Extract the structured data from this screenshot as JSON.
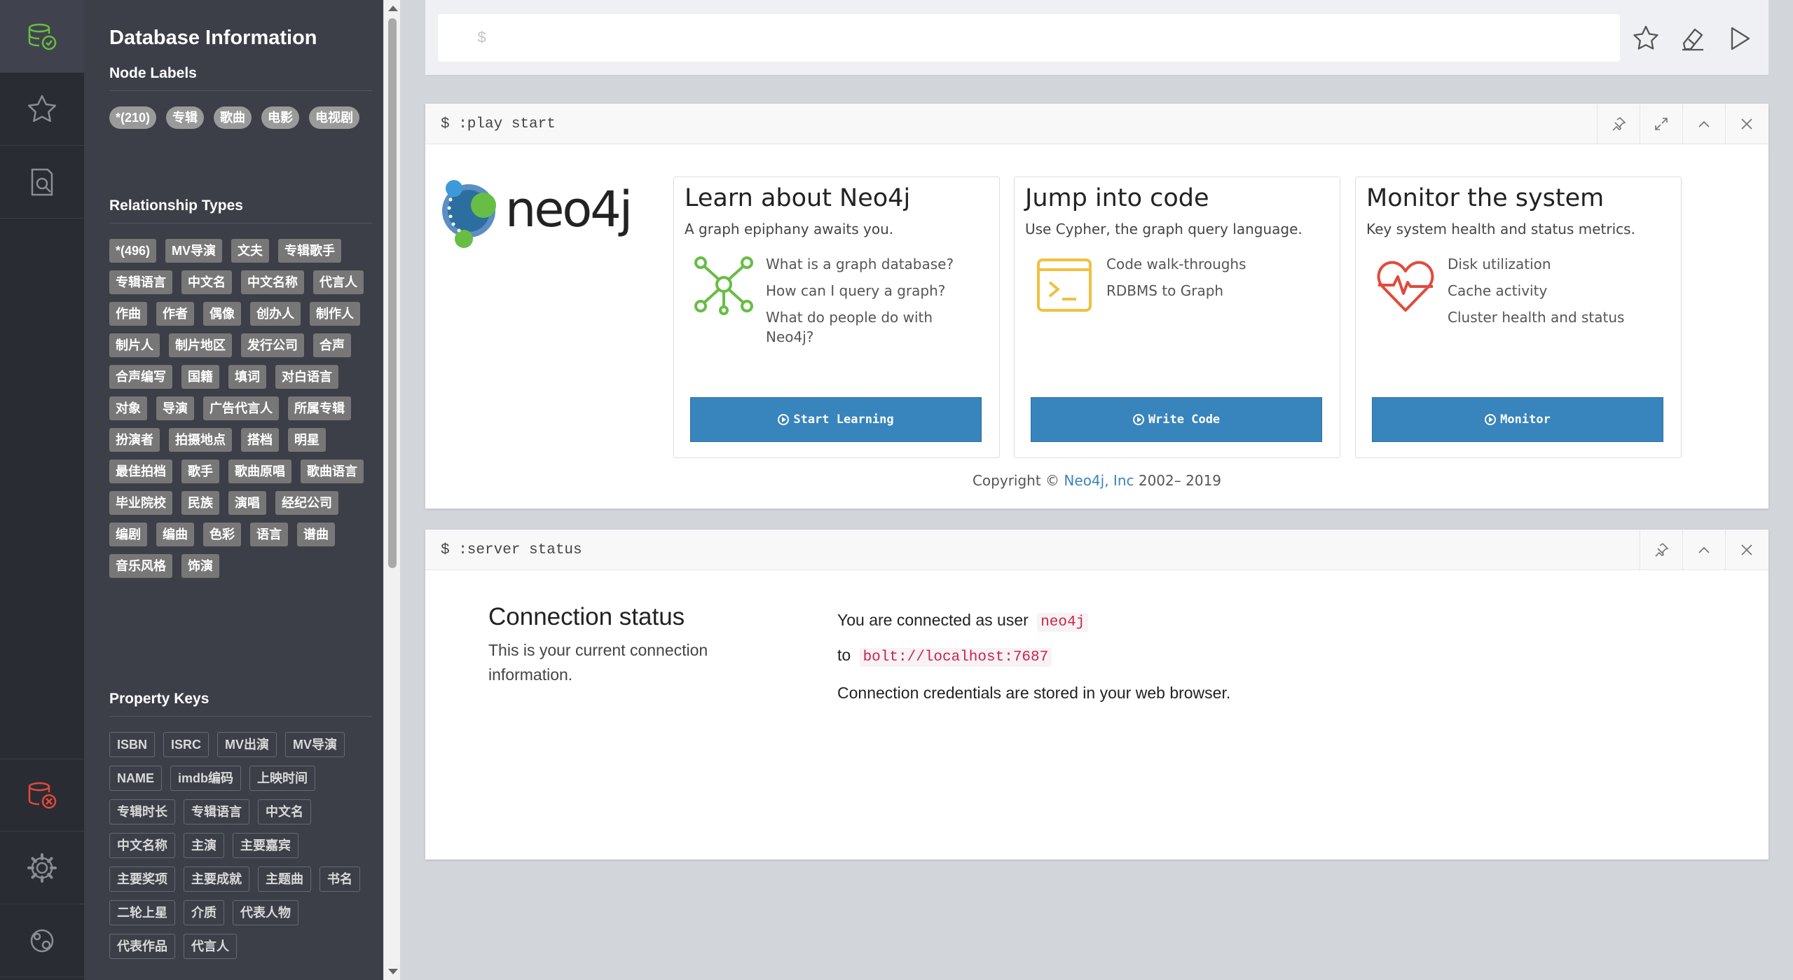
{
  "drawer": {
    "title": "Database Information",
    "node_labels": {
      "heading": "Node Labels",
      "items": [
        "*(210)",
        "专辑",
        "歌曲",
        "电影",
        "电视剧"
      ]
    },
    "relationship_types": {
      "heading": "Relationship Types",
      "items": [
        "*(496)",
        "MV导演",
        "文夫",
        "专辑歌手",
        "专辑语言",
        "中文名",
        "中文名称",
        "代言人",
        "作曲",
        "作者",
        "偶像",
        "创办人",
        "制作人",
        "制片人",
        "制片地区",
        "发行公司",
        "合声",
        "合声编写",
        "国籍",
        "填词",
        "对白语言",
        "对象",
        "导演",
        "广告代言人",
        "所属专辑",
        "扮演者",
        "拍摄地点",
        "搭档",
        "明星",
        "最佳拍档",
        "歌手",
        "歌曲原唱",
        "歌曲语言",
        "毕业院校",
        "民族",
        "演唱",
        "经纪公司",
        "编剧",
        "编曲",
        "色彩",
        "语言",
        "谱曲",
        "音乐风格",
        "饰演"
      ]
    },
    "property_keys": {
      "heading": "Property Keys",
      "items": [
        "ISBN",
        "ISRC",
        "MV出演",
        "MV导演",
        "NAME",
        "imdb编码",
        "上映时间",
        "专辑时长",
        "专辑语言",
        "中文名",
        "中文名称",
        "主演",
        "主要嘉宾",
        "主要奖项",
        "主要成就",
        "主题曲",
        "书名",
        "二轮上星",
        "介质",
        "代表人物",
        "代表作品",
        "代言人"
      ]
    }
  },
  "rail": {
    "icons": [
      "database-icon",
      "star-icon",
      "search-docs-icon",
      "disconnected-icon",
      "gear-icon",
      "neo4j-browser-icon"
    ]
  },
  "editor": {
    "prompt": "$"
  },
  "play_frame": {
    "command": "$ :play start",
    "logo_text": "neo4j",
    "cards": [
      {
        "title": "Learn about Neo4j",
        "subtitle": "A graph epiphany awaits you.",
        "items": [
          "What is a graph database?",
          "How can I query a graph?",
          "What do people do with Neo4j?"
        ],
        "button": "Start Learning"
      },
      {
        "title": "Jump into code",
        "subtitle": "Use Cypher, the graph query language.",
        "items": [
          "Code walk-throughs",
          "RDBMS to Graph"
        ],
        "button": "Write Code"
      },
      {
        "title": "Monitor the system",
        "subtitle": "Key system health and status metrics.",
        "items": [
          "Disk utilization",
          "Cache activity",
          "Cluster health and status"
        ],
        "button": "Monitor"
      }
    ],
    "copyright_prefix": "Copyright © ",
    "copyright_link": "Neo4j, Inc",
    "copyright_suffix": " 2002– 2019"
  },
  "status_frame": {
    "command": "$ :server status",
    "title": "Connection status",
    "description": "This is your current connection information.",
    "connected_prefix": "You are connected as user",
    "user": "neo4j",
    "to_prefix": "to",
    "url": "bolt://localhost:7687",
    "credentials_note": "Connection credentials are stored in your web browser."
  },
  "colors": {
    "accent": "#3884bd",
    "rail_bg": "#2a2c33",
    "drawer_bg": "#3c3f48",
    "green": "#68bd45",
    "warn_red": "#e24a3b"
  }
}
